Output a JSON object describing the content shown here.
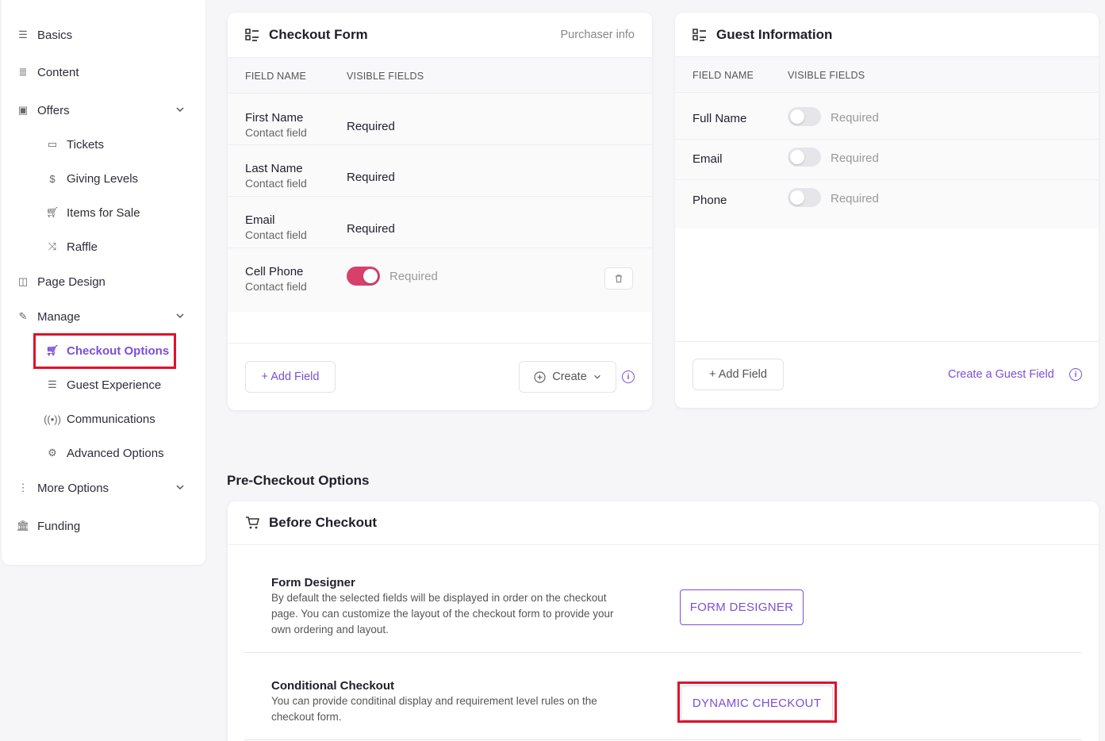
{
  "sidebar": {
    "items": [
      {
        "label": "Basics"
      },
      {
        "label": "Content"
      },
      {
        "label": "Offers"
      },
      {
        "label": "Tickets"
      },
      {
        "label": "Giving Levels"
      },
      {
        "label": "Items for Sale"
      },
      {
        "label": "Raffle"
      },
      {
        "label": "Page Design"
      },
      {
        "label": "Manage"
      },
      {
        "label": "Checkout Options"
      },
      {
        "label": "Guest Experience"
      },
      {
        "label": "Communications"
      },
      {
        "label": "Advanced Options"
      },
      {
        "label": "More Options"
      },
      {
        "label": "Funding"
      }
    ]
  },
  "checkout_form": {
    "title": "Checkout Form",
    "subtitle": "Purchaser info",
    "col_field": "FIELD NAME",
    "col_visible": "VISIBLE FIELDS",
    "rows": [
      {
        "name": "First Name",
        "sub": "Contact field",
        "status": "Required"
      },
      {
        "name": "Last Name",
        "sub": "Contact field",
        "status": "Required"
      },
      {
        "name": "Email",
        "sub": "Contact field",
        "status": "Required"
      },
      {
        "name": "Cell Phone",
        "sub": "Contact field",
        "status": "Required",
        "toggle_on": true
      }
    ],
    "add_field": "+ Add Field",
    "create": "Create"
  },
  "guest_info": {
    "title": "Guest Information",
    "col_field": "FIELD NAME",
    "col_visible": "VISIBLE FIELDS",
    "rows": [
      {
        "name": "Full Name",
        "status": "Required",
        "toggle_on": false
      },
      {
        "name": "Email",
        "status": "Required",
        "toggle_on": false
      },
      {
        "name": "Phone",
        "status": "Required",
        "toggle_on": false
      }
    ],
    "add_field": "+ Add Field",
    "create_link": "Create a Guest Field"
  },
  "pre_checkout": {
    "section_title": "Pre-Checkout Options",
    "card_title": "Before Checkout",
    "options": [
      {
        "title": "Form Designer",
        "desc_lines": [
          "By default the selected fields will be displayed in order on the checkout",
          "page. You can customize the layout of the checkout form to provide your",
          "own ordering and layout."
        ],
        "button": "FORM DESIGNER"
      },
      {
        "title": "Conditional Checkout",
        "desc_lines": [
          "You can provide conditinal display and requirement level rules on the",
          "checkout form."
        ],
        "button": "DYNAMIC CHECKOUT"
      }
    ]
  },
  "colors": {
    "accent": "#7b4fd8",
    "toggle_on": "#d6416b",
    "highlight": "#e0112b"
  }
}
